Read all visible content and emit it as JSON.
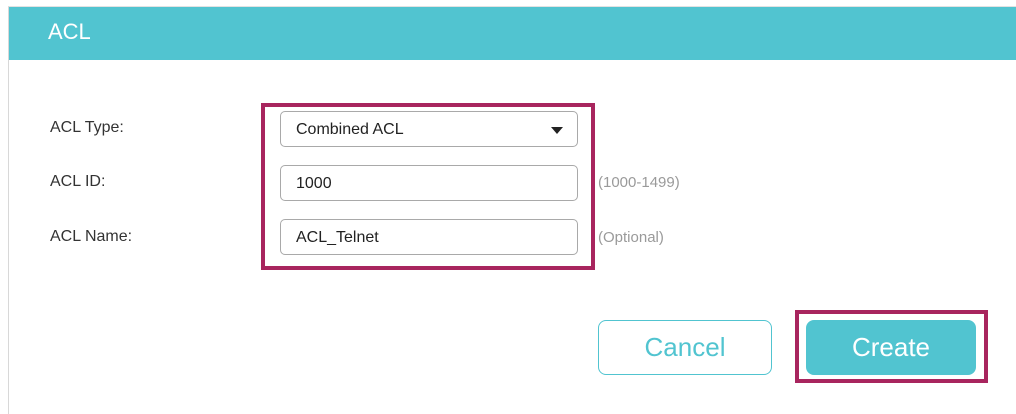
{
  "header": {
    "title": "ACL"
  },
  "form": {
    "acl_type": {
      "label": "ACL Type:",
      "value": "Combined ACL"
    },
    "acl_id": {
      "label": "ACL ID:",
      "value": "1000",
      "hint": "(1000-1499)"
    },
    "acl_name": {
      "label": "ACL Name:",
      "value": "ACL_Telnet",
      "hint": "(Optional)"
    }
  },
  "actions": {
    "cancel_label": "Cancel",
    "create_label": "Create"
  },
  "colors": {
    "accent": "#51c4d0",
    "highlight": "#a8255e"
  }
}
